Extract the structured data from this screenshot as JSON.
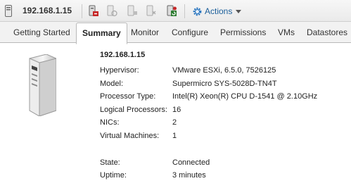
{
  "toolbar": {
    "host": "192.168.1.15",
    "actions_label": "Actions",
    "icons": [
      "host-icon",
      "maintenance-icon",
      "power-icon",
      "reboot-icon",
      "settings-icon",
      "refresh-icon",
      "gear-icon"
    ]
  },
  "tabs": [
    {
      "label": "Getting Started",
      "active": false
    },
    {
      "label": "Summary",
      "active": true
    },
    {
      "label": "Monitor",
      "active": false
    },
    {
      "label": "Configure",
      "active": false
    },
    {
      "label": "Permissions",
      "active": false
    },
    {
      "label": "VMs",
      "active": false
    },
    {
      "label": "Datastores",
      "active": false
    }
  ],
  "summary": {
    "title": "192.168.1.15",
    "rows": [
      {
        "label": "Hypervisor:",
        "value": "VMware ESXi, 6.5.0, 7526125"
      },
      {
        "label": "Model:",
        "value": "Supermicro SYS-5028D-TN4T"
      },
      {
        "label": "Processor Type:",
        "value": "Intel(R) Xeon(R) CPU D-1541 @ 2.10GHz"
      },
      {
        "label": "Logical Processors:",
        "value": "16"
      },
      {
        "label": "NICs:",
        "value": "2"
      },
      {
        "label": "Virtual Machines:",
        "value": "1"
      },
      {
        "label": "State:",
        "value": "Connected"
      },
      {
        "label": "Uptime:",
        "value": "3 minutes"
      }
    ]
  }
}
